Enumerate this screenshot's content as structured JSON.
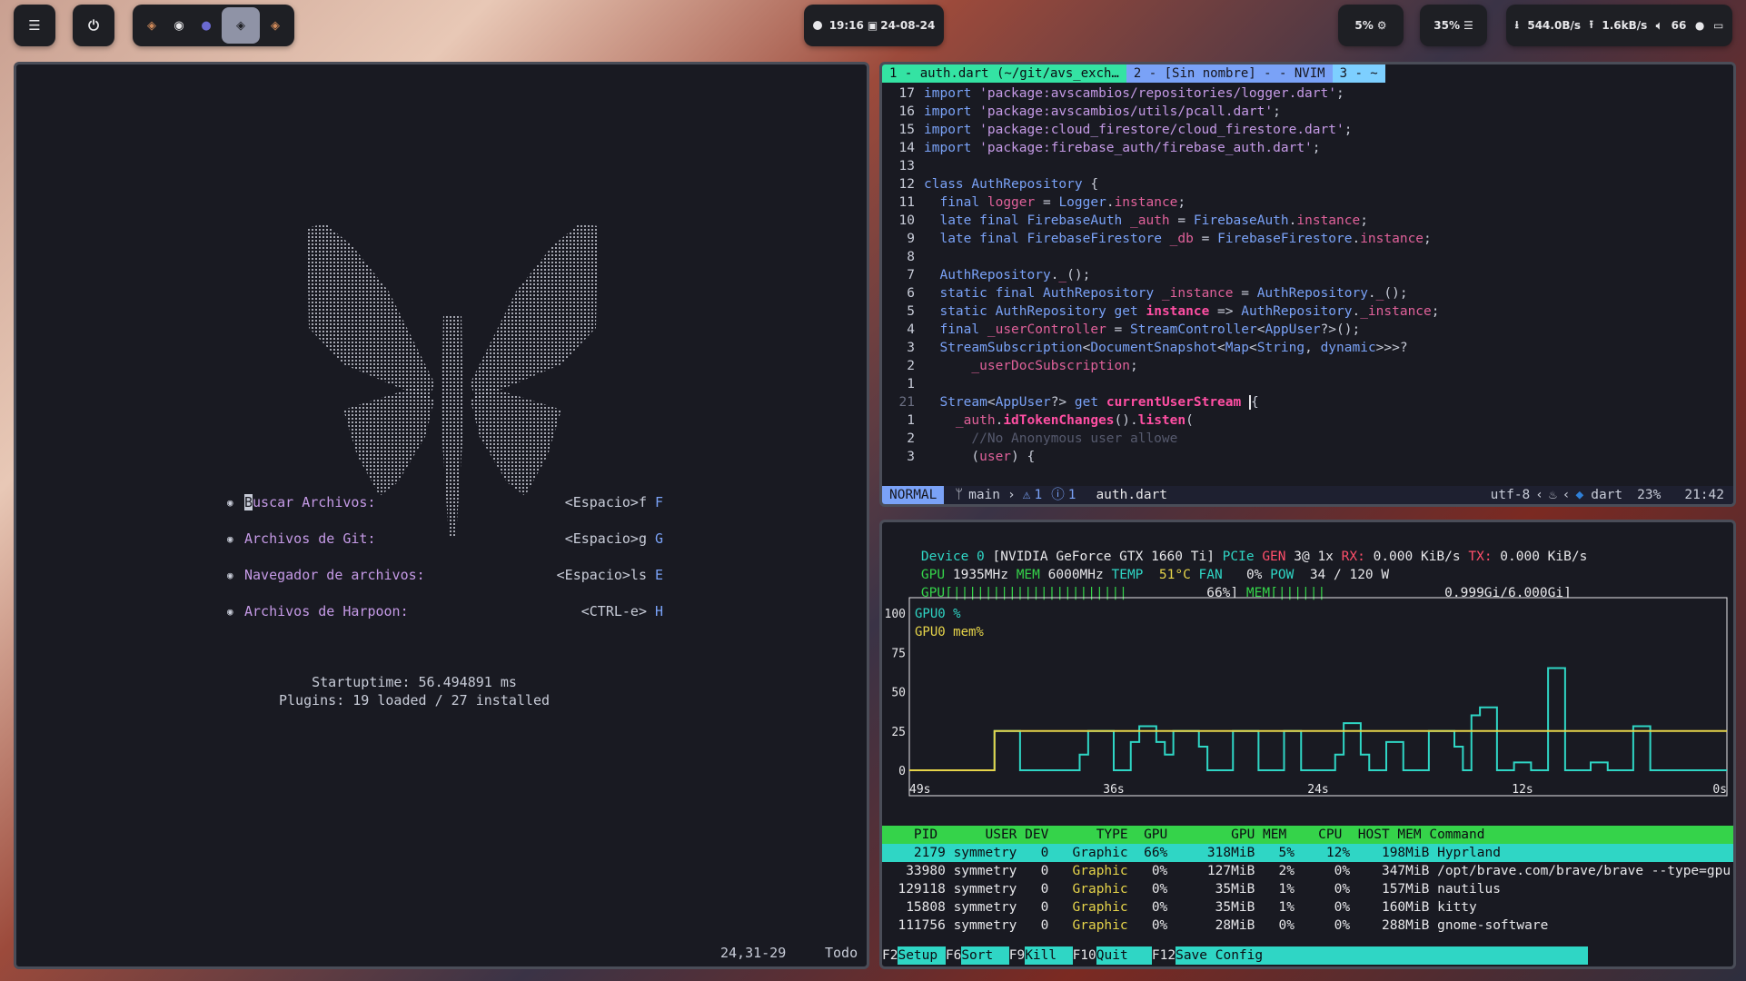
{
  "topbar": {
    "menu_icon": "☰",
    "power_icon": "⏻",
    "workspaces": [
      "W1",
      "W2",
      "W3",
      "W4",
      "W5"
    ],
    "clock_time": "19:16",
    "clock_date": "24-08-24",
    "cpu_label": "5%",
    "mem_label": "35%",
    "net_down": "544.0B/s",
    "net_up": "1.6kB/s",
    "volume": "66"
  },
  "dashboard": {
    "menu": [
      {
        "label": "Buscar Archivos:",
        "keys": "<Espacio>f",
        "hotkey": "F"
      },
      {
        "label": "Archivos de Git:",
        "keys": "<Espacio>g",
        "hotkey": "G"
      },
      {
        "label": "Navegador de archivos:",
        "keys": "<Espacio>ls",
        "hotkey": "E"
      },
      {
        "label": "Archivos de Harpoon:",
        "keys": "<CTRL-e>",
        "hotkey": "H"
      }
    ],
    "startup_time": "Startuptime: 56.494891 ms",
    "plugins": "Plugins: 19 loaded / 27 installed",
    "position": "24,31-29",
    "scroll": "Todo"
  },
  "nvim": {
    "tabs": [
      "1 - auth.dart (~/git/avs_exch…",
      "2 - [Sin nombre] - - NVIM",
      "3 - ~"
    ],
    "mode": "NORMAL",
    "branch": "main",
    "warnings": "1",
    "infos": "1",
    "filename": "auth.dart",
    "encoding": "utf-8",
    "filetype": "dart",
    "percent": "23%",
    "cursor_pos": "21:42"
  },
  "nvtop": {
    "device_line_1": "Device 0 [NVIDIA GeForce GTX 1660 Ti] PCIe GEN 3@ 1x RX: 0.000 KiB/s TX: 0.000 KiB/s",
    "gpu_clock": "1935MHz",
    "mem_clock": "6000MHz",
    "temp": "51°C",
    "fan": "0%",
    "power": "34 / 120 W",
    "gpu_util": "66%",
    "mem_used": "0.999Gi/6.000Gi",
    "legend_gpu": "GPU0 %",
    "legend_mem": "GPU0 mem%",
    "y_ticks": [
      "100",
      "75",
      "50",
      "25",
      "0"
    ],
    "x_ticks": [
      "49s",
      "36s",
      "24s",
      "12s",
      "0s"
    ],
    "headers": [
      "PID",
      "USER",
      "DEV",
      "TYPE",
      "GPU",
      "GPU MEM",
      "CPU",
      "HOST MEM",
      "Command"
    ],
    "processes": [
      {
        "pid": "2179",
        "user": "symmetry",
        "dev": "0",
        "type": "Graphic",
        "gpu": "66%",
        "gmem": "318MiB",
        "gmemp": "5%",
        "cpu": "12%",
        "hmem": "198MiB",
        "cmd": "Hyprland"
      },
      {
        "pid": "33980",
        "user": "symmetry",
        "dev": "0",
        "type": "Graphic",
        "gpu": "0%",
        "gmem": "127MiB",
        "gmemp": "2%",
        "cpu": "0%",
        "hmem": "347MiB",
        "cmd": "/opt/brave.com/brave/brave --type=gpu"
      },
      {
        "pid": "129118",
        "user": "symmetry",
        "dev": "0",
        "type": "Graphic",
        "gpu": "0%",
        "gmem": "35MiB",
        "gmemp": "1%",
        "cpu": "0%",
        "hmem": "157MiB",
        "cmd": "nautilus"
      },
      {
        "pid": "15808",
        "user": "symmetry",
        "dev": "0",
        "type": "Graphic",
        "gpu": "0%",
        "gmem": "35MiB",
        "gmemp": "1%",
        "cpu": "0%",
        "hmem": "160MiB",
        "cmd": "kitty"
      },
      {
        "pid": "111756",
        "user": "symmetry",
        "dev": "0",
        "type": "Graphic",
        "gpu": "0%",
        "gmem": "28MiB",
        "gmemp": "0%",
        "cpu": "0%",
        "hmem": "288MiB",
        "cmd": "gnome-software"
      }
    ],
    "fkeys": [
      {
        "key": "F2",
        "label": "Setup"
      },
      {
        "key": "F6",
        "label": "Sort"
      },
      {
        "key": "F9",
        "label": "Kill"
      },
      {
        "key": "F10",
        "label": "Quit"
      },
      {
        "key": "F12",
        "label": "Save Config"
      }
    ],
    "gpu_series": [
      0,
      0,
      0,
      0,
      0,
      0,
      0,
      0,
      0,
      0,
      25,
      25,
      25,
      0,
      0,
      0,
      0,
      0,
      0,
      0,
      10,
      25,
      25,
      25,
      0,
      0,
      18,
      28,
      28,
      18,
      10,
      25,
      25,
      25,
      15,
      0,
      0,
      0,
      25,
      25,
      25,
      0,
      0,
      0,
      25,
      25,
      0,
      0,
      0,
      0,
      10,
      30,
      30,
      10,
      0,
      0,
      18,
      18,
      0,
      0,
      0,
      25,
      25,
      25,
      15,
      0,
      35,
      40,
      40,
      0,
      0,
      5,
      5,
      0,
      0,
      65,
      65,
      0,
      0,
      0,
      5,
      5,
      0,
      0,
      0,
      28,
      28,
      0,
      0,
      0,
      0,
      0,
      0,
      0,
      0,
      0
    ],
    "mem_series": [
      0,
      0,
      0,
      0,
      0,
      0,
      0,
      0,
      0,
      0,
      25,
      25,
      25,
      25,
      25,
      25,
      25,
      25,
      25,
      25,
      25,
      25,
      25,
      25,
      25,
      25,
      25,
      25,
      25,
      25,
      25,
      25,
      25,
      25,
      25,
      25,
      25,
      25,
      25,
      25,
      25,
      25,
      25,
      25,
      25,
      25,
      25,
      25,
      25,
      25,
      25,
      25,
      25,
      25,
      25,
      25,
      25,
      25,
      25,
      25,
      25,
      25,
      25,
      25,
      25,
      25,
      25,
      25,
      25,
      25,
      25,
      25,
      25,
      25,
      25,
      25,
      25,
      25,
      25,
      25,
      25,
      25,
      25,
      25,
      25,
      25,
      25,
      25,
      25,
      25,
      25,
      25,
      25,
      25,
      25,
      25
    ]
  }
}
